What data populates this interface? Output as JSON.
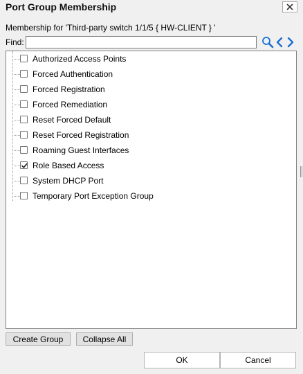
{
  "dialog": {
    "title": "Port Group Membership",
    "subtitle": "Membership for 'Third-party switch 1/1/5 { HW-CLIENT } '"
  },
  "find": {
    "label": "Find:",
    "value": "",
    "placeholder": ""
  },
  "tree": {
    "items": [
      {
        "label": "Authorized Access Points",
        "checked": false
      },
      {
        "label": "Forced Authentication",
        "checked": false
      },
      {
        "label": "Forced Registration",
        "checked": false
      },
      {
        "label": "Forced Remediation",
        "checked": false
      },
      {
        "label": "Reset Forced Default",
        "checked": false
      },
      {
        "label": "Reset Forced Registration",
        "checked": false
      },
      {
        "label": "Roaming Guest Interfaces",
        "checked": false
      },
      {
        "label": "Role Based Access",
        "checked": true
      },
      {
        "label": "System DHCP Port",
        "checked": false
      },
      {
        "label": "Temporary Port Exception Group",
        "checked": false
      }
    ]
  },
  "buttons": {
    "create_group": "Create Group",
    "collapse_all": "Collapse All",
    "ok": "OK",
    "cancel": "Cancel"
  },
  "icons": {
    "close": "close-icon",
    "search": "search-icon",
    "prev": "chevron-left-icon",
    "next": "chevron-right-icon"
  },
  "colors": {
    "nav_arrow": "#1e6fd0",
    "search": "#1e6fd0"
  }
}
